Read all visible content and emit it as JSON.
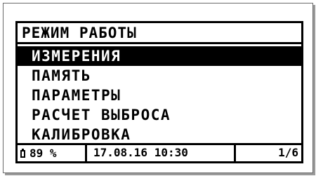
{
  "screen": {
    "title": "РЕЖИМ РАБОТЫ"
  },
  "menu": {
    "items": [
      {
        "label": "ИЗМЕРЕНИЯ",
        "selected": true
      },
      {
        "label": "ПАМЯТЬ",
        "selected": false
      },
      {
        "label": "ПАРАМЕТРЫ",
        "selected": false
      },
      {
        "label": "РАСЧЕТ ВЫБРОСА",
        "selected": false
      },
      {
        "label": "КАЛИБРОВКА",
        "selected": false
      }
    ]
  },
  "status": {
    "battery_icon": "battery-icon",
    "battery": "89 %",
    "datetime": "17.08.16 10:30",
    "page": "1/6"
  },
  "colors": {
    "foreground": "#000000",
    "background": "#ffffff",
    "selected_background": "#000000",
    "selected_foreground": "#ffffff"
  }
}
